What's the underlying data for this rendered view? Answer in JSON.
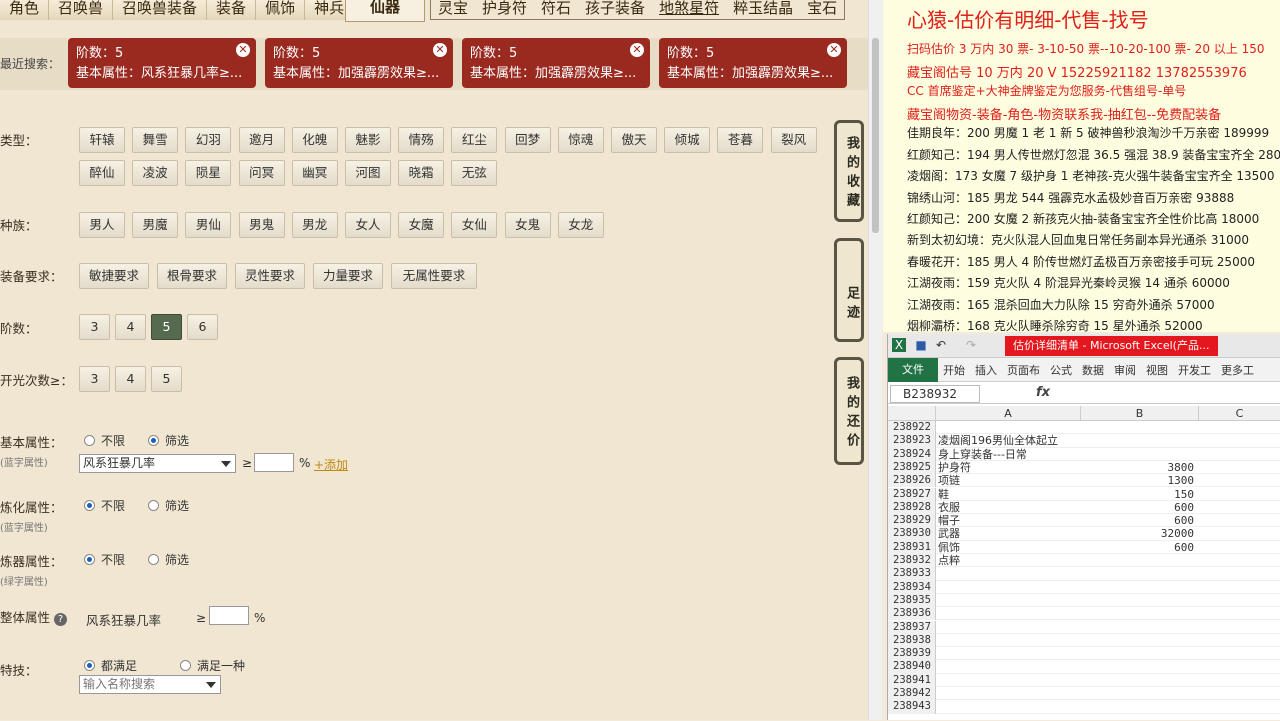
{
  "game": {
    "tabs_left": [
      "角色",
      "召唤兽",
      "召唤兽装备",
      "装备",
      "佩饰",
      "神兵"
    ],
    "active_tab": "仙器",
    "tabs_right": [
      "灵宝",
      "护身符",
      "符石",
      "孩子装备",
      "地煞星符",
      "粹玉结晶",
      "宝石"
    ],
    "recent": {
      "label": "最近搜索：",
      "chips": [
        {
          "l1": "阶数：5",
          "l2": "基本属性：风系狂暴几率≥..."
        },
        {
          "l1": "阶数：5",
          "l2": "基本属性：加强霹雳效果≥..."
        },
        {
          "l1": "阶数：5",
          "l2": "基本属性：加强霹雳效果≥..."
        },
        {
          "l1": "阶数：5",
          "l2": "基本属性：加强霹雳效果≥..."
        }
      ]
    },
    "type_label": "类型：",
    "types": [
      "轩辕",
      "舞雪",
      "幻羽",
      "邀月",
      "化魄",
      "魅影",
      "情殇",
      "红尘",
      "回梦",
      "惊魂",
      "傲天",
      "倾城",
      "苍暮",
      "裂风",
      "醉仙",
      "凌波",
      "陨星",
      "问冥",
      "幽冥",
      "河图",
      "晓霜",
      "无弦"
    ],
    "race_label": "种族：",
    "races": [
      "男人",
      "男魔",
      "男仙",
      "男鬼",
      "男龙",
      "女人",
      "女魔",
      "女仙",
      "女鬼",
      "女龙"
    ],
    "req_label": "装备要求：",
    "reqs": [
      "敏捷要求",
      "根骨要求",
      "灵性要求",
      "力量要求",
      "无属性要求"
    ],
    "tier_label": "阶数：",
    "tiers": [
      "3",
      "4",
      "5",
      "6"
    ],
    "open_label": "开光次数≥：",
    "opens": [
      "3",
      "4",
      "5"
    ],
    "basic_label": "基本属性：",
    "basic_sub": "(蓝字属性)",
    "unlimited": "不限",
    "filter": "筛选",
    "basic_select": "风系狂暴几率",
    "ge": "≥",
    "pct": "%",
    "add_link": "+添加",
    "refine_label": "炼化属性：",
    "refine_sub": "(蓝字属性)",
    "forge_label": "炼器属性：",
    "forge_sub": "(绿字属性)",
    "overall_label": "整体属性",
    "overall_attr": "风系狂暴几率",
    "skill_label": "特技：",
    "all_meet": "都满足",
    "any_meet": "满足一种",
    "skill_placeholder": "输入名称搜索",
    "side_fav": "我的收藏",
    "side_foot": "足迹",
    "side_bargain": "我的还价"
  },
  "ad": {
    "title": "心猿-估价有明细-代售-找号",
    "lines": [
      {
        "t": "扫码估价 3 万内 30 票- 3-10-50 票--10-20-100 票- 20 以上 150",
        "c": "red"
      },
      {
        "t": "藏宝阁估号 10 万内 20 V 15225921182   13782553976",
        "c": "red"
      },
      {
        "t": "CC 首席鉴定+大神金牌鉴定为您服务-代售组号-单号",
        "c": "red"
      },
      {
        "t": "藏宝阁物资-装备-角色-物资联系我-抽红包--免费配装备",
        "c": "red"
      },
      {
        "t": "佳期良年：200 男魔 1 老 1 新 5 破神兽秒浪淘沙千万亲密 189999",
        "c": "dk"
      },
      {
        "t": "红颜知己：194 男人传世燃灯忽混 36.5 强混 38.9 装备宝宝齐全 28000",
        "c": "dk"
      },
      {
        "t": "凌烟阁：173 女魔 7 级护身 1 老神孩-克火强牛装备宝宝齐全 13500",
        "c": "dk"
      },
      {
        "t": "锦绣山河：185 男龙 544 强霹克水孟极妙音百万亲密 93888",
        "c": "dk"
      },
      {
        "t": "红颜知己：200 女魔 2 新孩克火抽-装备宝宝齐全性价比高 18000",
        "c": "dk"
      },
      {
        "t": "新到太初幻境：克火队混人回血鬼日常任务副本异光通杀 31000",
        "c": "dk"
      },
      {
        "t": "春暖花开：185 男人 4 阶传世燃灯孟极百万亲密接手可玩 25000",
        "c": "dk"
      },
      {
        "t": "江湖夜雨：159 克火队 4 阶混异光秦岭灵猴 14 通杀 60000",
        "c": "dk"
      },
      {
        "t": "江湖夜雨：165 混杀回血大力队除 15 穷奇外通杀 57000",
        "c": "dk"
      },
      {
        "t": "烟柳灞桥：168 克火队睡杀除穷奇 15 星外通杀 52000",
        "c": "dk"
      }
    ]
  },
  "excel": {
    "title": "估价详细清单 - Microsoft Excel(产品...",
    "file_tab": "文件",
    "ribbon": [
      "开始",
      "插入",
      "页面布",
      "公式",
      "数据",
      "审阅",
      "视图",
      "开发工",
      "更多工"
    ],
    "name_box": "B238932",
    "fx": "fx",
    "cols": [
      "A",
      "B",
      "C"
    ],
    "rows": [
      {
        "n": "238922",
        "a": "",
        "b": ""
      },
      {
        "n": "238923",
        "a": "凌烟阁196男仙全体起立",
        "b": ""
      },
      {
        "n": "238924",
        "a": "身上穿装备---日常",
        "b": ""
      },
      {
        "n": "238925",
        "a": "护身符",
        "b": "3800"
      },
      {
        "n": "238926",
        "a": "项链",
        "b": "1300"
      },
      {
        "n": "238927",
        "a": "鞋",
        "b": "150"
      },
      {
        "n": "238928",
        "a": "衣服",
        "b": "600"
      },
      {
        "n": "238929",
        "a": "帽子",
        "b": "600"
      },
      {
        "n": "238930",
        "a": "武器",
        "b": "32000"
      },
      {
        "n": "238931",
        "a": "佩饰",
        "b": "600"
      },
      {
        "n": "238932",
        "a": "点粹",
        "b": ""
      },
      {
        "n": "238933",
        "a": "",
        "b": ""
      },
      {
        "n": "238934",
        "a": "",
        "b": ""
      },
      {
        "n": "238935",
        "a": "",
        "b": ""
      },
      {
        "n": "238936",
        "a": "",
        "b": ""
      },
      {
        "n": "238937",
        "a": "",
        "b": ""
      },
      {
        "n": "238938",
        "a": "",
        "b": ""
      },
      {
        "n": "238939",
        "a": "",
        "b": ""
      },
      {
        "n": "238940",
        "a": "",
        "b": ""
      },
      {
        "n": "238941",
        "a": "",
        "b": ""
      },
      {
        "n": "238942",
        "a": "",
        "b": ""
      },
      {
        "n": "238943",
        "a": "",
        "b": ""
      }
    ]
  }
}
